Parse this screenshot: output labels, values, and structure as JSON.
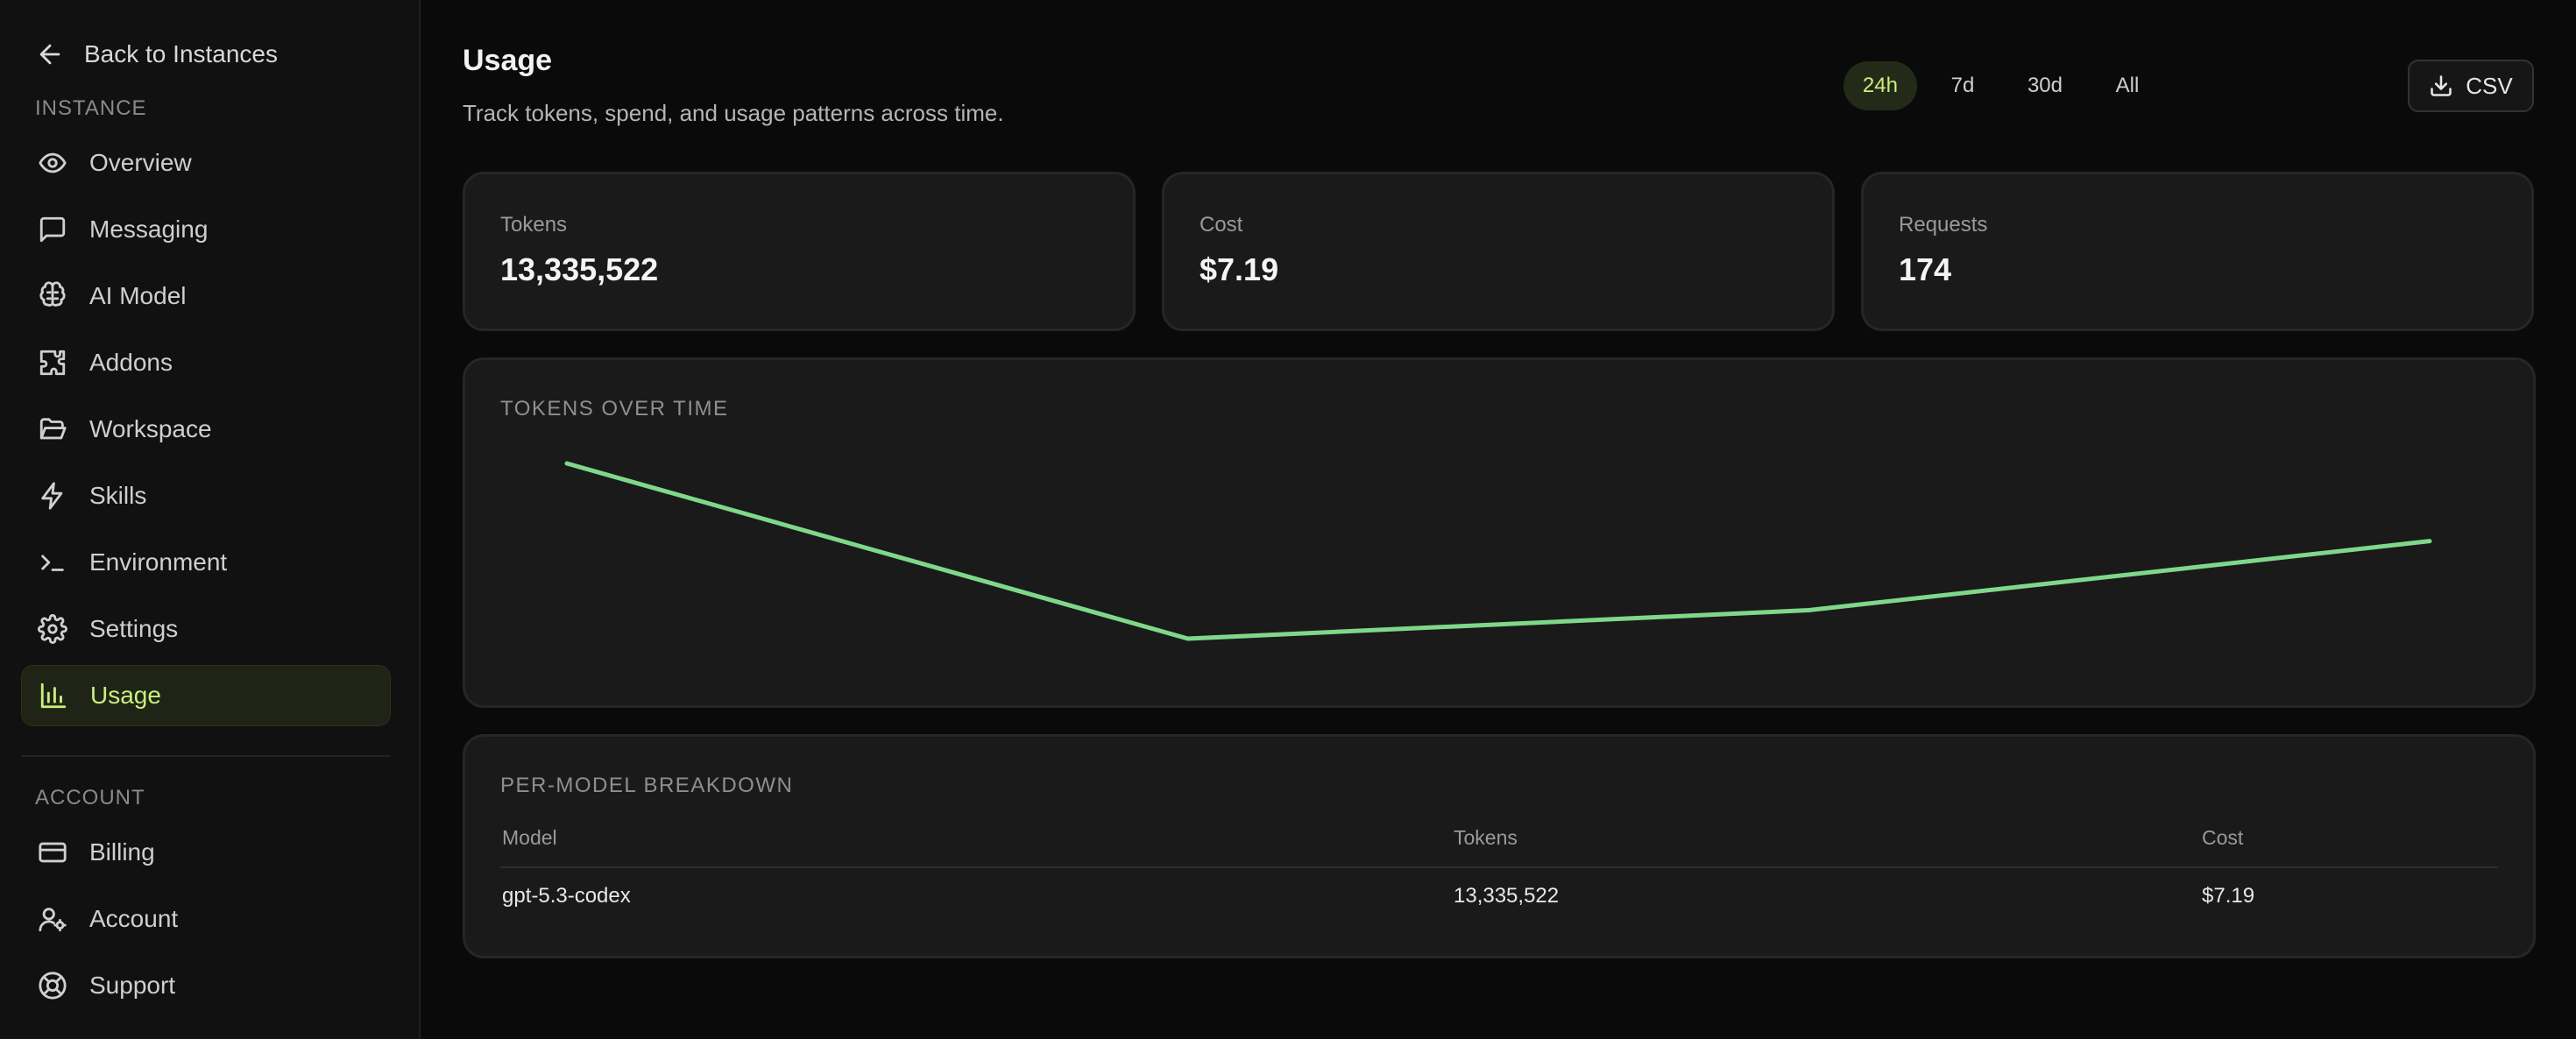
{
  "sidebar": {
    "back_label": "Back to Instances",
    "instance_section": "Instance",
    "account_section": "Account",
    "instance_items": [
      {
        "label": "Overview",
        "icon": "eye-icon"
      },
      {
        "label": "Messaging",
        "icon": "message-square-icon"
      },
      {
        "label": "AI Model",
        "icon": "brain-icon"
      },
      {
        "label": "Addons",
        "icon": "puzzle-icon"
      },
      {
        "label": "Workspace",
        "icon": "folder-open-icon"
      },
      {
        "label": "Skills",
        "icon": "zap-icon"
      },
      {
        "label": "Environment",
        "icon": "terminal-icon"
      },
      {
        "label": "Settings",
        "icon": "gear-icon"
      },
      {
        "label": "Usage",
        "icon": "bar-chart-icon",
        "active": true
      }
    ],
    "account_items": [
      {
        "label": "Billing",
        "icon": "credit-card-icon"
      },
      {
        "label": "Account",
        "icon": "user-gear-icon"
      },
      {
        "label": "Support",
        "icon": "life-buoy-icon"
      }
    ]
  },
  "header": {
    "title": "Usage",
    "subtitle": "Track tokens, spend, and usage patterns across time."
  },
  "range_options": [
    "24h",
    "7d",
    "30d",
    "All"
  ],
  "selected_range": "24h",
  "csv_label": "CSV",
  "stats": [
    {
      "label": "Tokens",
      "value": "13,335,522"
    },
    {
      "label": "Cost",
      "value": "$7.19"
    },
    {
      "label": "Requests",
      "value": "174"
    }
  ],
  "chart_title": "Tokens over time",
  "chart_data": {
    "type": "line",
    "title": "Tokens over time",
    "xlabel": "",
    "ylabel": "",
    "grid": false,
    "series": [
      {
        "values": [
          5200000,
          1320000,
          1950000,
          3480000
        ]
      }
    ],
    "color": "#7fd88a"
  },
  "breakdown": {
    "title": "Per-model breakdown",
    "columns": [
      "Model",
      "Tokens",
      "Cost"
    ],
    "rows": [
      [
        "gpt-5.3-codex",
        "13,335,522",
        "$7.19"
      ]
    ]
  },
  "colors": {
    "accent": "#c9ef7f",
    "line": "#7fd88a",
    "background": "#0a0a0a",
    "card": "#1a1a1a"
  }
}
